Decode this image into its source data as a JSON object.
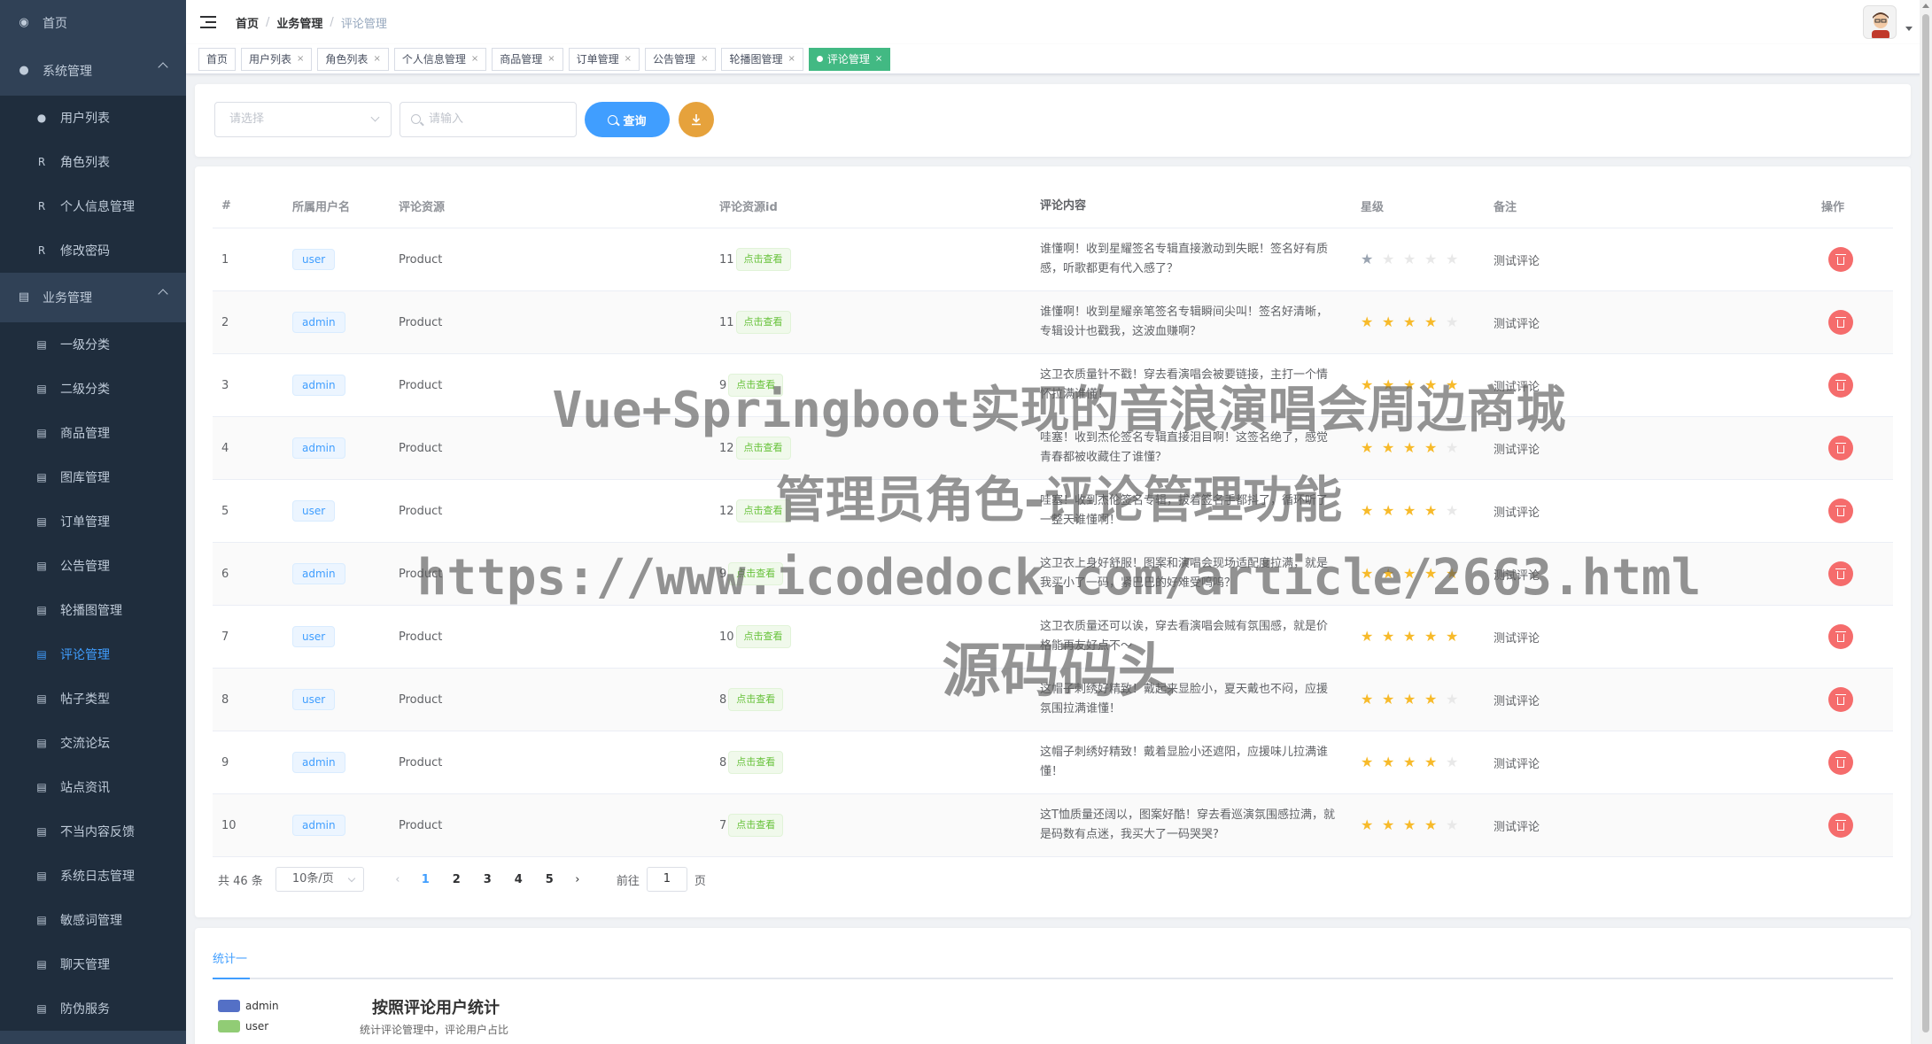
{
  "sidebar": {
    "home": "首页",
    "system": {
      "label": "系统管理",
      "items": [
        "用户列表",
        "角色列表",
        "个人信息管理",
        "修改密码"
      ]
    },
    "business": {
      "label": "业务管理",
      "items": [
        "一级分类",
        "二级分类",
        "商品管理",
        "图库管理",
        "订单管理",
        "公告管理",
        "轮播图管理",
        "评论管理",
        "帖子类型",
        "交流论坛",
        "站点资讯",
        "不当内容反馈",
        "系统日志管理",
        "敏感词管理",
        "聊天管理",
        "防伪服务"
      ]
    }
  },
  "breadcrumb": [
    "首页",
    "业务管理",
    "评论管理"
  ],
  "tags": [
    "首页",
    "用户列表",
    "角色列表",
    "个人信息管理",
    "商品管理",
    "订单管理",
    "公告管理",
    "轮播图管理",
    "评论管理"
  ],
  "filter": {
    "select_placeholder": "请选择",
    "input_placeholder": "请输入",
    "query_label": "查询"
  },
  "table": {
    "headers": [
      "#",
      "所属用户名",
      "评论资源",
      "评论资源id",
      "评论内容",
      "星级",
      "备注",
      "操作"
    ],
    "view_label": "点击查看",
    "rows": [
      {
        "no": "1",
        "user": "user",
        "res": "Product",
        "rid": "11",
        "content": "谁懂啊！收到星耀签名专辑直接激动到失眠！签名好有质感，听歌都更有代入感了？",
        "stars": 1,
        "remark": "测试评论"
      },
      {
        "no": "2",
        "user": "admin",
        "res": "Product",
        "rid": "11",
        "content": "谁懂啊！收到星耀亲笔签名专辑瞬间尖叫！签名好清晰，专辑设计也戳我，这波血赚啊？",
        "stars": 4,
        "remark": "测试评论"
      },
      {
        "no": "3",
        "user": "admin",
        "res": "Product",
        "rid": "9",
        "content": "这卫衣质量针不戳！穿去看演唱会被要链接，主打一个情怀拉满谁懂！",
        "stars": 5,
        "remark": "测试评论"
      },
      {
        "no": "4",
        "user": "admin",
        "res": "Product",
        "rid": "12",
        "content": "哇塞！收到杰伦签名专辑直接泪目啊！这签名绝了，感觉青春都被收藏住了谁懂？",
        "stars": 4,
        "remark": "测试评论"
      },
      {
        "no": "5",
        "user": "user",
        "res": "Product",
        "rid": "12",
        "content": "哇塞！收到杰伦签名专辑，拔着签名手都抖了，循环听了一整天谁懂啊！",
        "stars": 4,
        "remark": "测试评论"
      },
      {
        "no": "6",
        "user": "admin",
        "res": "Product",
        "rid": "9",
        "content": "这卫衣上身好舒服！图案和演唱会现场适配度拉满，就是我买小了一码，紧巴巴的好难受呜呜？",
        "stars": 5,
        "remark": "测试评论"
      },
      {
        "no": "7",
        "user": "user",
        "res": "Product",
        "rid": "10",
        "content": "这卫衣质量还可以诶，穿去看演唱会贼有氛围感，就是价格能再友好点不～",
        "stars": 5,
        "remark": "测试评论"
      },
      {
        "no": "8",
        "user": "user",
        "res": "Product",
        "rid": "8",
        "content": "这帽子刺绣好精致！戴起来显脸小，夏天戴也不闷，应援氛围拉满谁懂！",
        "stars": 4,
        "remark": "测试评论"
      },
      {
        "no": "9",
        "user": "admin",
        "res": "Product",
        "rid": "8",
        "content": "这帽子刺绣好精致！戴着显脸小还遮阳，应援味儿拉满谁懂！",
        "stars": 4,
        "remark": "测试评论"
      },
      {
        "no": "10",
        "user": "admin",
        "res": "Product",
        "rid": "7",
        "content": "这T恤质量还阔以，图案好酷！穿去看巡演氛围感拉满，就是码数有点迷，我买大了一码哭哭?",
        "stars": 4,
        "remark": "测试评论"
      }
    ]
  },
  "pagination": {
    "total": "共 46 条",
    "size": "10条/页",
    "pages": [
      "1",
      "2",
      "3",
      "4",
      "5"
    ],
    "goto_label": "前往",
    "goto_value": "1",
    "page_suffix": "页"
  },
  "stats": {
    "tab": "统计一",
    "legend": [
      {
        "name": "admin",
        "color": "#5470c6"
      },
      {
        "name": "user",
        "color": "#91cc75"
      }
    ],
    "title": "按照评论用户统计",
    "subtitle": "统计评论管理中，评论用户占比"
  },
  "watermark": {
    "line1": "Vue+Springboot实现的音浪演唱会周边商城",
    "line2": "管理员角色-评论管理功能",
    "line3": "https://www.icodedock.com/article/2663.html",
    "line4": "源码码头"
  },
  "colors": {
    "sidebar_bg": "#304156",
    "primary": "#409eff",
    "success": "#42b983",
    "danger": "#f56c6c",
    "warning": "#e6a23c",
    "star": "#f7ba2a"
  }
}
